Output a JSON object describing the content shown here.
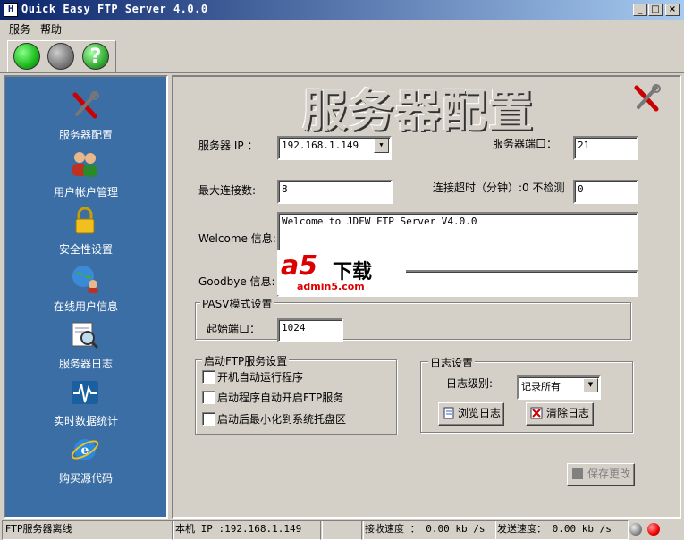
{
  "window": {
    "title": "Quick Easy FTP Server 4.0.0",
    "icon_text": "H",
    "min": "_",
    "max": "□",
    "close": "×"
  },
  "menu": [
    "服务",
    "帮助"
  ],
  "toolbar": {
    "start_icon": "green-circle-icon",
    "stop_icon": "gray-circle-icon",
    "help_icon": "question-mark-icon",
    "help_glyph": "?",
    "colors": {
      "start": "#22c022",
      "stop": "#808080",
      "help": "#3cb43c"
    }
  },
  "sidebar": {
    "items": [
      {
        "label": "服务器配置",
        "icon": "tools-icon"
      },
      {
        "label": "用户帐户管理",
        "icon": "users-icon"
      },
      {
        "label": "安全性设置",
        "icon": "lock-icon"
      },
      {
        "label": "在线用户信息",
        "icon": "globe-users-icon"
      },
      {
        "label": "服务器日志",
        "icon": "log-magnifier-icon"
      },
      {
        "label": "实时数据统计",
        "icon": "pulse-icon"
      },
      {
        "label": "购买源代码",
        "icon": "ie-globe-icon"
      }
    ]
  },
  "main": {
    "title": "服务器配置",
    "server_ip_label": "服务器 IP ：",
    "server_ip": "192.168.1.149",
    "server_port_label": "服务器端口：",
    "server_port": "21",
    "max_conn_label": "最大连接数:",
    "max_conn": "8",
    "timeout_label": "连接超时（分钟）:0 不检测",
    "timeout": "0",
    "welcome_label": "Welcome 信息:",
    "welcome_text": "Welcome to JDFW  FTP Server V4.0.0",
    "goodbye_label": "Goodbye 信息:",
    "goodbye_text": "",
    "pasv_group": "PASV模式设置",
    "start_port_label": "起始端口：",
    "start_port": "1024",
    "startup_group": "启动FTP服务设置",
    "startup_options": [
      "开机自动运行程序",
      "启动程序自动开启FTP服务",
      "启动后最小化到系统托盘区"
    ],
    "log_group": "日志设置",
    "log_level_label": "日志级别:",
    "log_level": "记录所有",
    "browse_log": "浏览日志",
    "clear_log": "清除日志",
    "save_button": "保存更改",
    "watermark_a5": "a5",
    "watermark_xiazai": "下载",
    "watermark_url": "admin5.com"
  },
  "status": {
    "server_state": "FTP服务器离线",
    "local_ip": "本机 IP :192.168.1.149",
    "recv": "接收速度 ： 0.00   kb /s",
    "send": "发送速度： 0.00   kb /s"
  }
}
